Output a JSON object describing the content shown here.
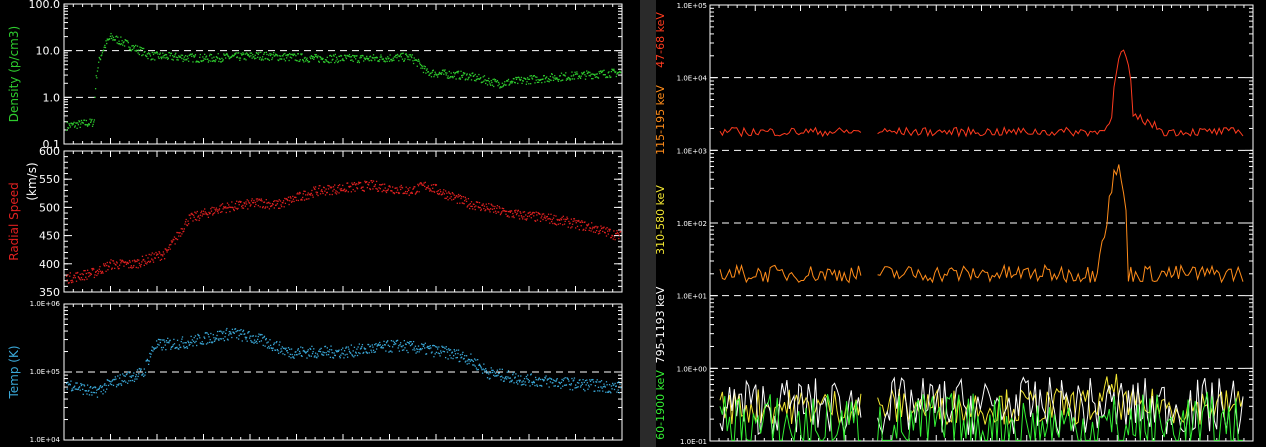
{
  "colors": {
    "background": "#000000",
    "axes": "#ffffff",
    "density": "#2ecc2e",
    "speed": "#e02020",
    "temp": "#3aa8d8",
    "e1": "#ff3b1f",
    "e2": "#ff8c1a",
    "e3": "#f2e632",
    "e4": "#ffffff",
    "e5": "#33ee33"
  },
  "panels": [
    {
      "id": "density",
      "ylabel": "Density (p/cm3)",
      "ylabel_color": "#2ecc2e",
      "scale": "log",
      "ylim": [
        0.1,
        100
      ],
      "ticks": [
        "0.1",
        "1.0",
        "10.0",
        "100.0"
      ],
      "dashed": [
        1,
        10
      ]
    },
    {
      "id": "speed",
      "ylabel": "Radial Speed",
      "ylabel_unit": "(km/s)",
      "ylabel_color": "#e02020",
      "scale": "linear",
      "ylim": [
        350,
        600
      ],
      "ticks": [
        "350",
        "400",
        "450",
        "500",
        "550",
        "600"
      ],
      "dashed": []
    },
    {
      "id": "temp",
      "ylabel": "Temp (K)",
      "ylabel_color": "#3aa8d8",
      "scale": "log",
      "ylim": [
        10000,
        1000000
      ],
      "ticks": [
        "1.0E+04",
        "1.0E+05",
        "1.0E+06"
      ],
      "dashed": [
        100000
      ]
    }
  ],
  "energy_panel": {
    "scale": "log",
    "ylim": [
      0.1,
      100000
    ],
    "ticks": [
      "1.0E-01",
      "1.0E+00",
      "1.0E+01",
      "1.0E+02",
      "1.0E+03",
      "1.0E+04",
      "1.0E+05"
    ],
    "dashed": [
      1,
      10,
      100,
      1000,
      10000
    ],
    "channels": [
      {
        "label": "47-68 keV",
        "color": "#ff3b1f"
      },
      {
        "label": "115-195 keV",
        "color": "#ff8c1a"
      },
      {
        "label": "310-580 keV",
        "color": "#f2e632"
      },
      {
        "label": "795-1193 keV",
        "color": "#ffffff"
      },
      {
        "label": "60-1900 keV",
        "color": "#33ee33"
      }
    ]
  },
  "chart_data": [
    {
      "type": "scatter",
      "ylabel": "Density (p/cm3)",
      "yscale": "log",
      "ylim": [
        0.1,
        100
      ],
      "series": [
        {
          "name": "Density",
          "points": [
            [
              0.0,
              0.25
            ],
            [
              0.05,
              0.3
            ],
            [
              0.08,
              20
            ],
            [
              0.12,
              12
            ],
            [
              0.15,
              8
            ],
            [
              0.25,
              7
            ],
            [
              0.35,
              8
            ],
            [
              0.45,
              7
            ],
            [
              0.55,
              7
            ],
            [
              0.62,
              7.5
            ],
            [
              0.65,
              3.5
            ],
            [
              0.72,
              3
            ],
            [
              0.78,
              2
            ],
            [
              0.84,
              2.5
            ],
            [
              0.92,
              3
            ],
            [
              1.0,
              3.5
            ]
          ]
        }
      ]
    },
    {
      "type": "scatter",
      "ylabel": "Radial Speed (km/s)",
      "ylim": [
        350,
        600
      ],
      "series": [
        {
          "name": "Radial Speed",
          "points": [
            [
              0.0,
              375
            ],
            [
              0.05,
              385
            ],
            [
              0.08,
              400
            ],
            [
              0.12,
              400
            ],
            [
              0.18,
              420
            ],
            [
              0.22,
              480
            ],
            [
              0.28,
              500
            ],
            [
              0.32,
              505
            ],
            [
              0.35,
              510
            ],
            [
              0.38,
              505
            ],
            [
              0.45,
              530
            ],
            [
              0.55,
              540
            ],
            [
              0.62,
              530
            ],
            [
              0.65,
              540
            ],
            [
              0.72,
              510
            ],
            [
              0.8,
              490
            ],
            [
              0.88,
              480
            ],
            [
              0.95,
              465
            ],
            [
              1.0,
              450
            ]
          ]
        }
      ]
    },
    {
      "type": "scatter",
      "ylabel": "Temp (K)",
      "yscale": "log",
      "ylim": [
        10000,
        1000000
      ],
      "series": [
        {
          "name": "Temp",
          "points": [
            [
              0.0,
              70000
            ],
            [
              0.05,
              50000
            ],
            [
              0.1,
              80000
            ],
            [
              0.14,
              100000
            ],
            [
              0.16,
              250000
            ],
            [
              0.22,
              280000
            ],
            [
              0.3,
              380000
            ],
            [
              0.35,
              300000
            ],
            [
              0.4,
              200000
            ],
            [
              0.5,
              200000
            ],
            [
              0.6,
              250000
            ],
            [
              0.68,
              200000
            ],
            [
              0.72,
              170000
            ],
            [
              0.76,
              100000
            ],
            [
              0.82,
              80000
            ],
            [
              0.9,
              70000
            ],
            [
              1.0,
              60000
            ]
          ]
        }
      ]
    },
    {
      "type": "line",
      "yscale": "log",
      "ylim": [
        0.1,
        100000
      ],
      "series": [
        {
          "name": "47-68 keV",
          "points": [
            [
              0.0,
              1800
            ],
            [
              0.2,
              1800
            ],
            [
              0.36,
              1800
            ],
            [
              0.5,
              1800
            ],
            [
              0.73,
              1800
            ],
            [
              0.75,
              3000
            ],
            [
              0.77,
              25000
            ],
            [
              0.79,
              3000
            ],
            [
              0.85,
              1800
            ],
            [
              1.0,
              1800
            ]
          ]
        },
        {
          "name": "115-195 keV",
          "points": [
            [
              0.0,
              20
            ],
            [
              0.2,
              20
            ],
            [
              0.36,
              20
            ],
            [
              0.5,
              20
            ],
            [
              0.72,
              20
            ],
            [
              0.74,
              100
            ],
            [
              0.76,
              600
            ],
            [
              0.78,
              20
            ],
            [
              0.85,
              20
            ],
            [
              1.0,
              20
            ]
          ]
        },
        {
          "name": "310-580 keV",
          "points": [
            [
              0.0,
              0.3
            ],
            [
              0.2,
              0.3
            ],
            [
              0.36,
              0.3
            ],
            [
              0.5,
              0.3
            ],
            [
              0.73,
              0.3
            ],
            [
              0.75,
              0.6
            ],
            [
              0.77,
              0.3
            ],
            [
              1.0,
              0.3
            ]
          ]
        },
        {
          "name": "795-1193 keV",
          "points": [
            [
              0.0,
              0.3
            ],
            [
              0.5,
              0.3
            ],
            [
              1.0,
              0.3
            ]
          ]
        },
        {
          "name": "60-1900 keV",
          "points": [
            [
              0.0,
              0.15
            ],
            [
              0.5,
              0.15
            ],
            [
              1.0,
              0.15
            ]
          ]
        }
      ]
    }
  ]
}
